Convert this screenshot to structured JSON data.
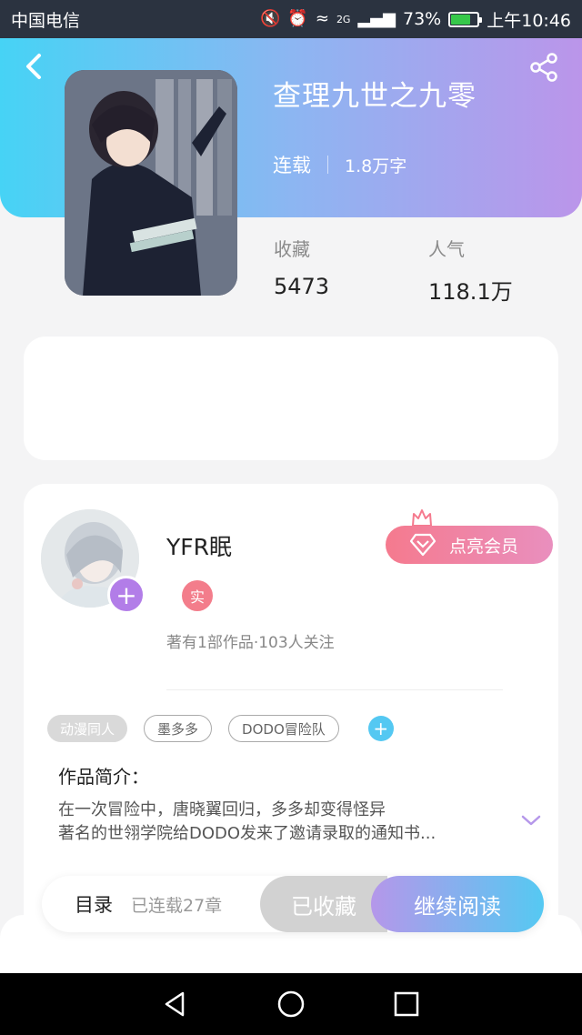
{
  "status_bar": {
    "carrier": "中国电信",
    "network": "2G",
    "battery": "73%",
    "battery_level": 0.73,
    "time": "上午10:46"
  },
  "book": {
    "title": "查理九世之九零",
    "status": "连载",
    "word_count": "1.8万字",
    "stats": [
      {
        "label": "收藏",
        "value": "5473"
      },
      {
        "label": "人气",
        "value": "118.1万"
      }
    ]
  },
  "author": {
    "name": "YFR眠",
    "badge": "实",
    "info": "著有1部作品·103人关注",
    "vip_button": "点亮会员"
  },
  "tags": [
    "动漫同人",
    "墨多多",
    "DODO冒险队"
  ],
  "intro": {
    "label": "作品简介：",
    "line1": "在一次冒险中，唐晓翼回归，多多却变得怪异",
    "line2": "著名的世翎学院给DODO发来了邀请录取的通知书..."
  },
  "action_bar": {
    "toc": "目录",
    "chapter_count": "已连载27章",
    "collected": "已收藏",
    "continue_reading": "继续阅读"
  },
  "colors": {
    "header_start": "#46d3f5",
    "header_end": "#bb95ea",
    "vip": "#f57a8e",
    "accent_blue": "#55c9f2",
    "accent_purple": "#b27de8"
  }
}
